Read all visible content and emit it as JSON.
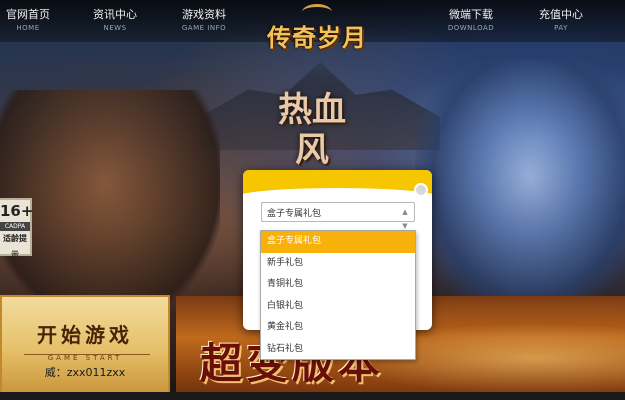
{
  "nav": {
    "items": [
      {
        "cn": "官网首页",
        "en": "HOME"
      },
      {
        "cn": "资讯中心",
        "en": "NEWS"
      },
      {
        "cn": "游戏资料",
        "en": "GAME INFO"
      },
      {
        "cn": "微端下载",
        "en": "DOWNLOAD"
      },
      {
        "cn": "充值中心",
        "en": "PAY"
      }
    ],
    "logo_text": "传奇岁月"
  },
  "hero": {
    "title": "热血风"
  },
  "age_badge": {
    "age": "16+",
    "cadpa": "CADPA",
    "tip": "适龄提示"
  },
  "start_game": {
    "title": "开始游戏",
    "subtitle": "GAME START",
    "contact": "威：zxx011zxx"
  },
  "promo": {
    "text": "超变版本"
  },
  "gift_modal": {
    "select_value": "盒子专属礼包",
    "options": [
      "盒子专属礼包",
      "新手礼包",
      "青铜礼包",
      "白银礼包",
      "黄金礼包",
      "钻石礼包"
    ],
    "selected_index": 0,
    "accent_color": "#f6c600",
    "highlight_color": "#f8b10a"
  }
}
